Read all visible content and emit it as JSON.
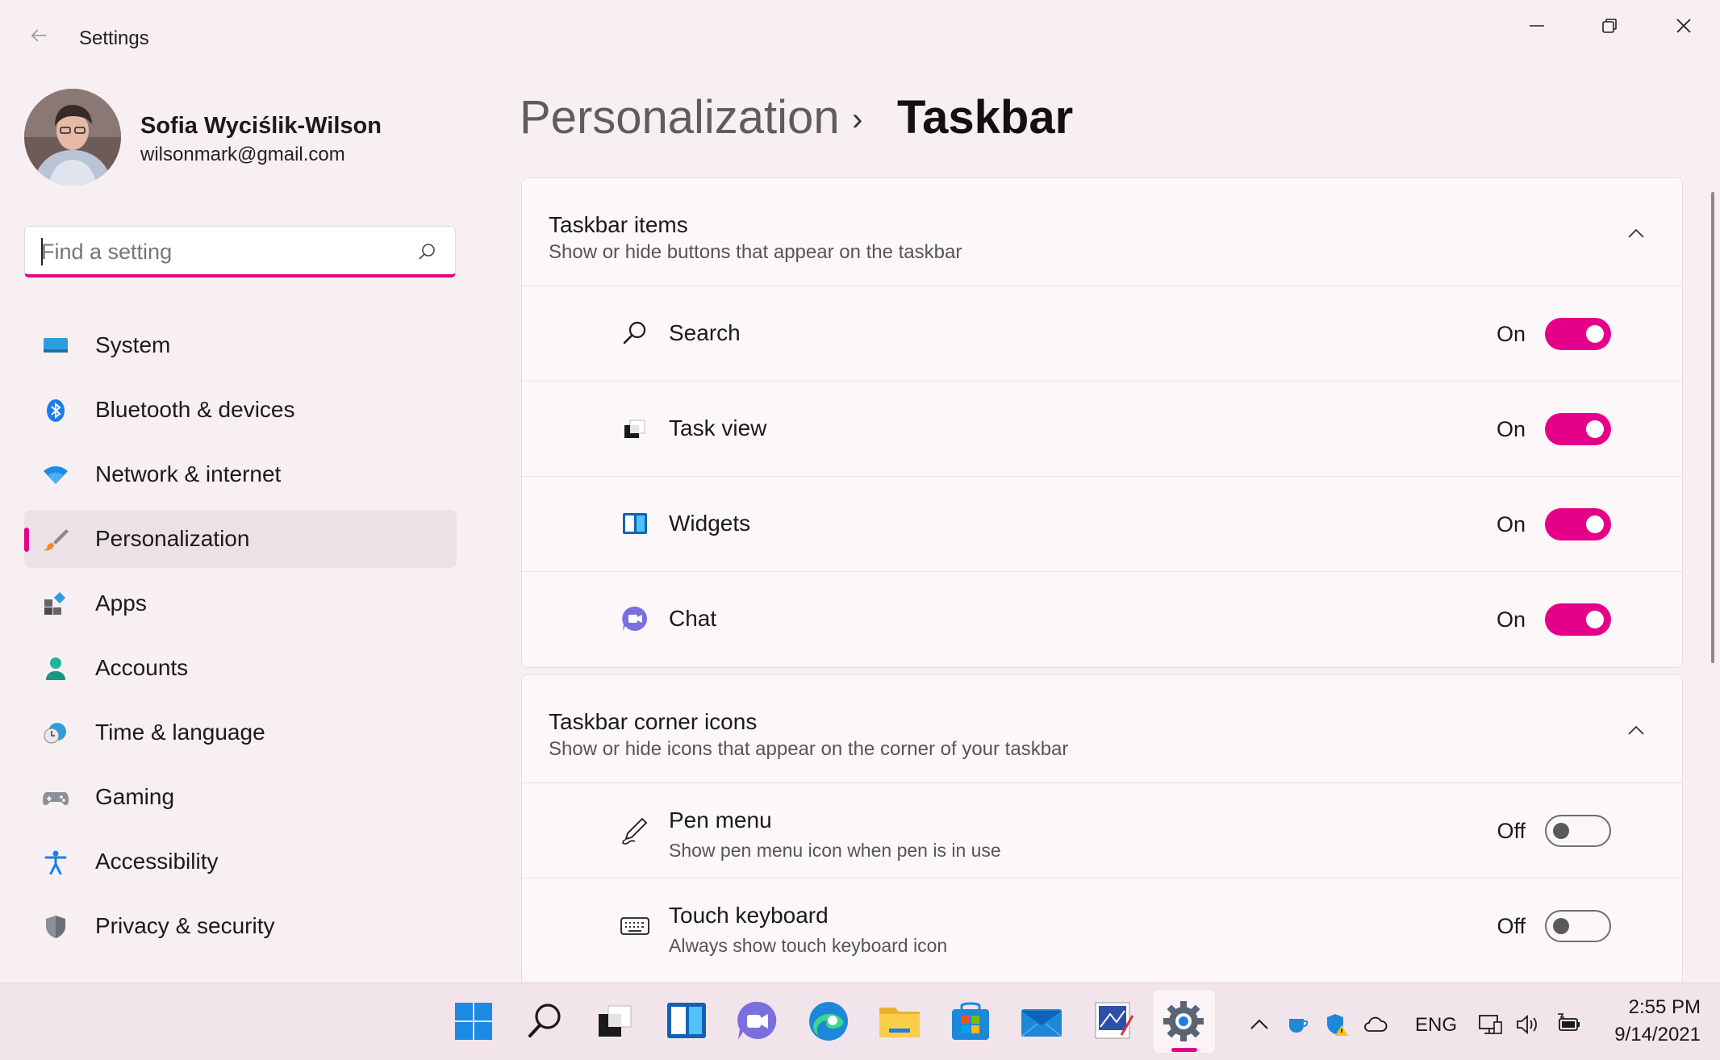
{
  "window": {
    "title": "Settings"
  },
  "profile": {
    "name": "Sofia Wyciślik-Wilson",
    "email": "wilsonmark@gmail.com"
  },
  "search": {
    "placeholder": "Find a setting",
    "value": ""
  },
  "nav": {
    "items": [
      {
        "label": "System",
        "icon": "system-icon"
      },
      {
        "label": "Bluetooth & devices",
        "icon": "bluetooth-icon"
      },
      {
        "label": "Network & internet",
        "icon": "wifi-icon"
      },
      {
        "label": "Personalization",
        "icon": "brush-icon",
        "active": true
      },
      {
        "label": "Apps",
        "icon": "apps-icon"
      },
      {
        "label": "Accounts",
        "icon": "person-icon"
      },
      {
        "label": "Time & language",
        "icon": "clock-globe-icon"
      },
      {
        "label": "Gaming",
        "icon": "gamepad-icon"
      },
      {
        "label": "Accessibility",
        "icon": "accessibility-icon"
      },
      {
        "label": "Privacy & security",
        "icon": "shield-icon"
      }
    ]
  },
  "breadcrumb": {
    "parent": "Personalization",
    "separator": "›",
    "current": "Taskbar"
  },
  "taskbar_items": {
    "title": "Taskbar items",
    "subtitle": "Show or hide buttons that appear on the taskbar",
    "rows": [
      {
        "label": "Search",
        "state": "On",
        "on": true,
        "icon": "search-icon"
      },
      {
        "label": "Task view",
        "state": "On",
        "on": true,
        "icon": "task-view-icon"
      },
      {
        "label": "Widgets",
        "state": "On",
        "on": true,
        "icon": "widgets-icon"
      },
      {
        "label": "Chat",
        "state": "On",
        "on": true,
        "icon": "chat-icon"
      }
    ]
  },
  "corner_icons": {
    "title": "Taskbar corner icons",
    "subtitle": "Show or hide icons that appear on the corner of your taskbar",
    "rows": [
      {
        "label": "Pen menu",
        "desc": "Show pen menu icon when pen is in use",
        "state": "Off",
        "on": false,
        "icon": "pen-icon"
      },
      {
        "label": "Touch keyboard",
        "desc": "Always show touch keyboard icon",
        "state": "Off",
        "on": false,
        "icon": "keyboard-icon"
      }
    ]
  },
  "taskbar": {
    "lang": "ENG",
    "time": "2:55 PM",
    "date": "9/14/2021"
  },
  "colors": {
    "accent": "#e5008a",
    "background": "#f8eff3"
  }
}
